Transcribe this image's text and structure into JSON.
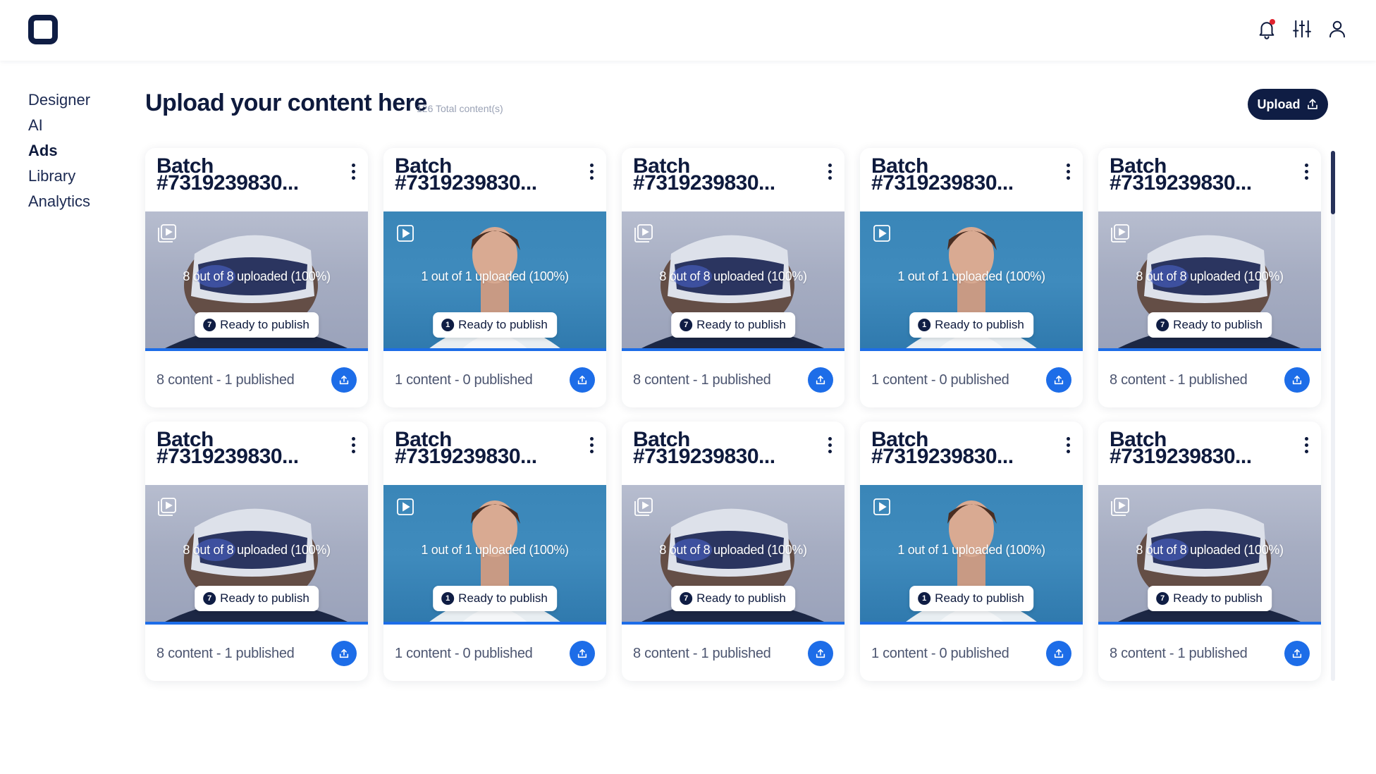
{
  "header": {
    "logo": "rounded-square-logo",
    "icons": [
      "bell-icon",
      "sliders-icon",
      "user-icon"
    ],
    "has_notification": true
  },
  "sidebar": {
    "items": [
      {
        "label": "Designer",
        "active": false
      },
      {
        "label": "AI",
        "active": false
      },
      {
        "label": "Ads",
        "active": true
      },
      {
        "label": "Library",
        "active": false
      },
      {
        "label": "Analytics",
        "active": false
      }
    ]
  },
  "main": {
    "title": "Upload your content here",
    "total": "126 Total content(s)",
    "upload_label": "Upload"
  },
  "cards": [
    {
      "title_line1": "Batch",
      "title_line2": "#7319239830...",
      "image": "vr",
      "upload_status": "8 out of 8 uploaded (100%)",
      "status_count": "7",
      "status_label": "Ready to publish",
      "meta": "8 content - 1 published",
      "progress": 1.0
    },
    {
      "title_line1": "Batch",
      "title_line2": "#7319239830...",
      "image": "portrait",
      "upload_status": "1 out of 1 uploaded (100%)",
      "status_count": "1",
      "status_label": "Ready to publish",
      "meta": "1 content - 0 published",
      "progress": 1.0
    },
    {
      "title_line1": "Batch",
      "title_line2": "#7319239830...",
      "image": "vr",
      "upload_status": "8 out of 8 uploaded (100%)",
      "status_count": "7",
      "status_label": "Ready to publish",
      "meta": "8 content - 1 published",
      "progress": 1.0
    },
    {
      "title_line1": "Batch",
      "title_line2": "#7319239830...",
      "image": "portrait",
      "upload_status": "1 out of 1 uploaded (100%)",
      "status_count": "1",
      "status_label": "Ready to publish",
      "meta": "1 content - 0 published",
      "progress": 1.0
    },
    {
      "title_line1": "Batch",
      "title_line2": "#7319239830...",
      "image": "vr",
      "upload_status": "8 out of 8 uploaded (100%)",
      "status_count": "7",
      "status_label": "Ready to publish",
      "meta": "8 content - 1 published",
      "progress": 1.0
    },
    {
      "title_line1": "Batch",
      "title_line2": "#7319239830...",
      "image": "vr",
      "upload_status": "8 out of 8 uploaded (100%)",
      "status_count": "7",
      "status_label": "Ready to publish",
      "meta": "8 content - 1 published",
      "progress": 1.0
    },
    {
      "title_line1": "Batch",
      "title_line2": "#7319239830...",
      "image": "portrait",
      "upload_status": "1 out of 1 uploaded (100%)",
      "status_count": "1",
      "status_label": "Ready to publish",
      "meta": "1 content - 0 published",
      "progress": 1.0
    },
    {
      "title_line1": "Batch",
      "title_line2": "#7319239830...",
      "image": "vr",
      "upload_status": "8 out of 8 uploaded (100%)",
      "status_count": "7",
      "status_label": "Ready to publish",
      "meta": "8 content - 1 published",
      "progress": 1.0
    },
    {
      "title_line1": "Batch",
      "title_line2": "#7319239830...",
      "image": "portrait",
      "upload_status": "1 out of 1 uploaded (100%)",
      "status_count": "1",
      "status_label": "Ready to publish",
      "meta": "1 content - 0 published",
      "progress": 1.0
    },
    {
      "title_line1": "Batch",
      "title_line2": "#7319239830...",
      "image": "vr",
      "upload_status": "8 out of 8 uploaded (100%)",
      "status_count": "7",
      "status_label": "Ready to publish",
      "meta": "8 content - 1 published",
      "progress": 1.0
    }
  ],
  "colors": {
    "navy": "#0f1d44",
    "accent_blue": "#1d6de8",
    "muted_text": "#9aa2b5"
  }
}
